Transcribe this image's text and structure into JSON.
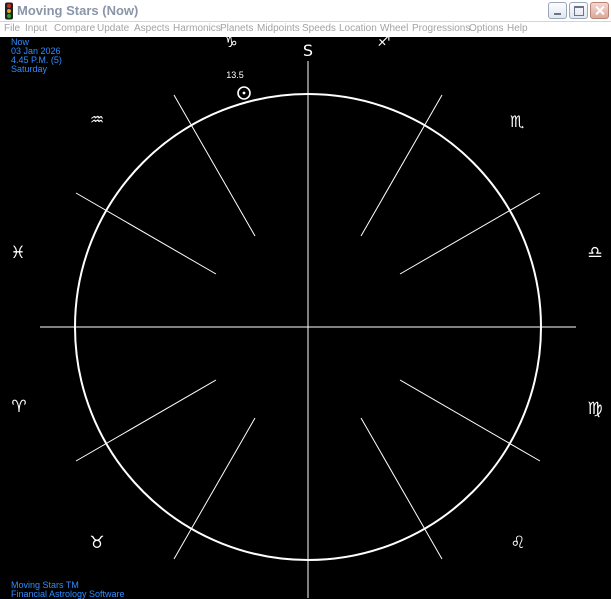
{
  "window": {
    "title": "Moving Stars (Now)",
    "app_icon": "traffic-light-icon",
    "controls": {
      "minimize_icon": "minimize-icon",
      "maximize_icon": "maximize-icon",
      "close_icon": "close-icon"
    }
  },
  "menu": [
    "File",
    "Input",
    "Compare",
    "Update",
    "Aspects",
    "Harmonics",
    "Planets",
    "Midpoints",
    "Speeds",
    "Location",
    "Wheel",
    "Progressions",
    "Options",
    "Help"
  ],
  "info": {
    "label": "Now",
    "date": "03 Jan 2026",
    "time": "4.45 P.M. (5)",
    "weekday": "Saturday"
  },
  "footer": {
    "line1": "Moving Stars TM",
    "line2": "Financial Astrology Software"
  },
  "wheel": {
    "top_marker": "S",
    "signs": [
      "Capricorn",
      "Sagittarius",
      "Scorpio",
      "Libra",
      "Virgo",
      "Leo",
      "Taurus",
      "Aries",
      "Pisces",
      "Aquarius"
    ],
    "sun_label": "13.5",
    "line_color": "#ffffff",
    "background": "#000000",
    "accent": "#2f8cff"
  }
}
